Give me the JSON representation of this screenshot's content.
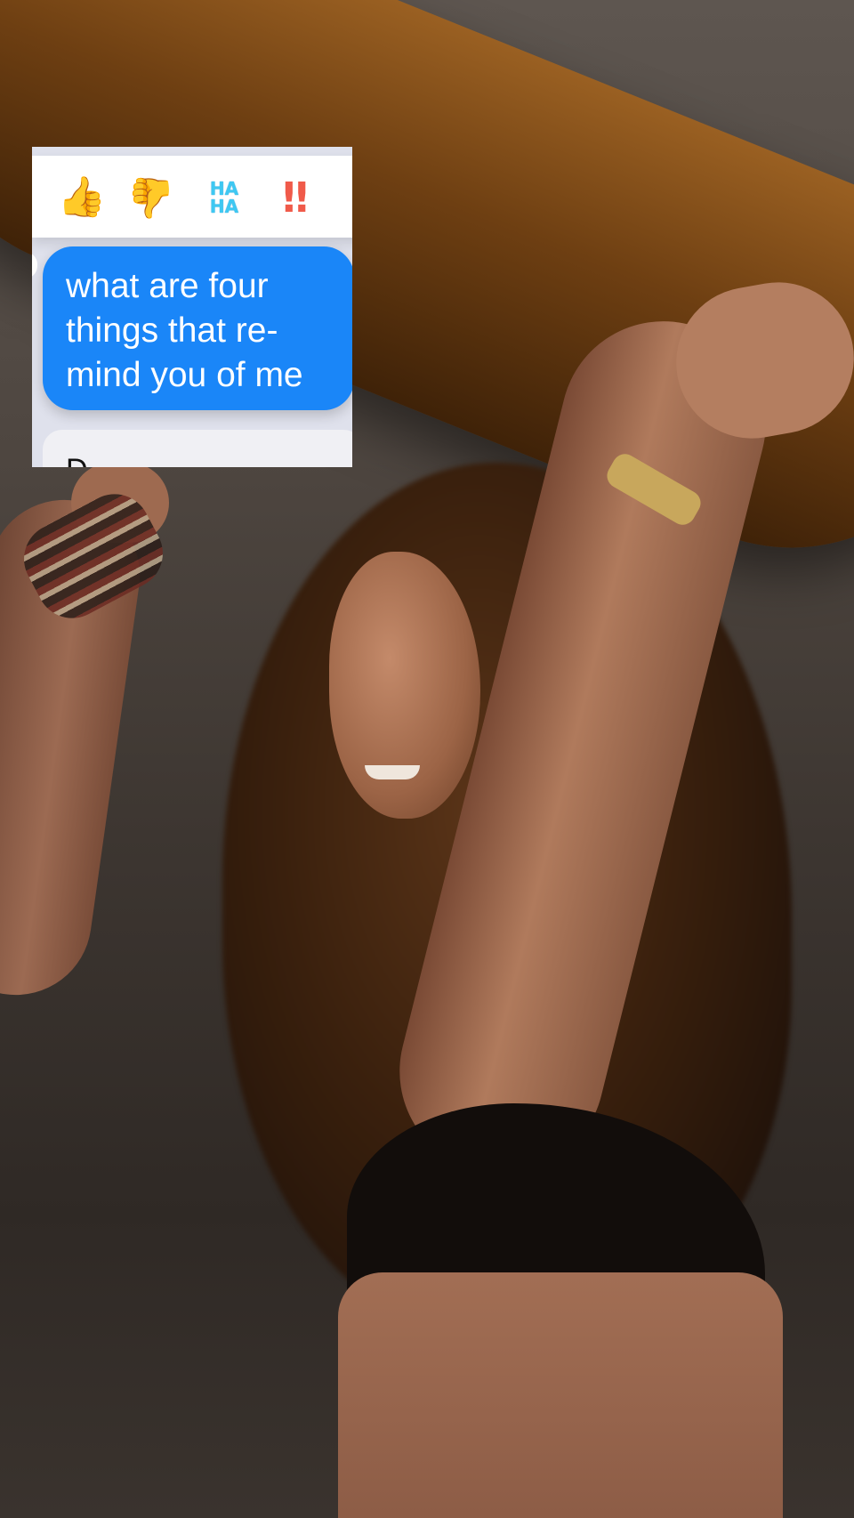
{
  "message": {
    "lines": [
      "what are four",
      "things that re-",
      "mind you of me"
    ],
    "bubble_color": "#1a86f8"
  },
  "tapbacks": [
    {
      "icon": "thumbs-up-icon",
      "glyph": "👍"
    },
    {
      "icon": "thumbs-down-icon",
      "glyph": "👍"
    },
    {
      "icon": "haha-icon",
      "glyph_top": "HA",
      "glyph_bottom": "HA"
    },
    {
      "icon": "exclamation-icon",
      "glyph": "‼"
    },
    {
      "icon": "question-icon",
      "glyph": ""
    }
  ],
  "next_message": {
    "partial_text": "D"
  }
}
